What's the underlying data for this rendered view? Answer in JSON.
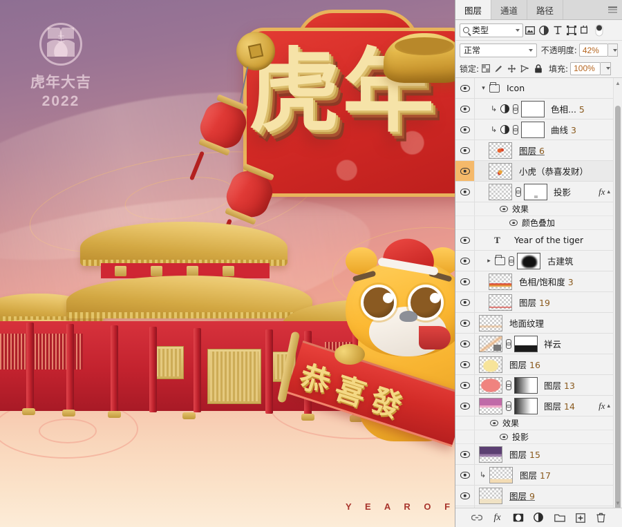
{
  "artwork": {
    "logo": {
      "brand_cn": "虎年大吉",
      "year": "2022",
      "mark": "tiger-head-icon"
    },
    "headline": "虎年",
    "banner_text": "恭喜發",
    "bottom_text": "Y E A R   O F   T H",
    "decor": [
      "red-lantern",
      "gold-coin",
      "gold-ingot",
      "palace-architecture",
      "tiger-mascot"
    ]
  },
  "panel": {
    "tabs": [
      {
        "label": "图层",
        "active": true
      },
      {
        "label": "通道",
        "active": false
      },
      {
        "label": "路径",
        "active": false
      }
    ],
    "menu_icon": "panel-menu-icon",
    "filter": {
      "search_icon": "search-icon",
      "type_label": "类型",
      "icons": [
        "pixel-filter-icon",
        "adjustment-filter-icon",
        "type-filter-icon",
        "shape-filter-icon",
        "smartobject-filter-icon"
      ],
      "toggle": "filter-toggle"
    },
    "blend": {
      "mode": "正常",
      "opacity_label": "不透明度:",
      "opacity_value": "42%"
    },
    "lock": {
      "label": "锁定:",
      "icons": [
        "lock-transparent-icon",
        "lock-image-icon",
        "lock-position-icon",
        "lock-artboard-icon",
        "lock-all-icon"
      ],
      "fill_label": "填充:",
      "fill_value": "100%"
    },
    "layers": [
      {
        "name": "Icon",
        "kind": "group",
        "expanded": true,
        "visible": true,
        "indent": 0,
        "thumb": "none"
      },
      {
        "name": "色相...",
        "num": "5",
        "kind": "adjustment",
        "visible": true,
        "clipped": true,
        "mask": "white",
        "linked": true,
        "indent": 1
      },
      {
        "name": "曲线",
        "num": "3",
        "kind": "adjustment",
        "visible": true,
        "clipped": true,
        "mask": "white",
        "linked": true,
        "indent": 1
      },
      {
        "name": "图层",
        "num": "6",
        "kind": "pixel",
        "visible": true,
        "indent": 1,
        "underline": true,
        "thumb": "confetti"
      },
      {
        "name": "小虎（恭喜发财）",
        "kind": "pixel",
        "visible": true,
        "selected": true,
        "indent": 1,
        "thumb": "tiger"
      },
      {
        "name": "投影",
        "kind": "pixel",
        "visible": true,
        "indent": 1,
        "mask": "white",
        "linked": true,
        "fx": true,
        "effects": [
          {
            "name": "效果"
          },
          {
            "name": "颜色叠加"
          }
        ]
      },
      {
        "name": "Year of the tiger",
        "kind": "text",
        "visible": true,
        "indent": 1
      },
      {
        "name": "古建筑",
        "kind": "group",
        "expanded": false,
        "visible": true,
        "indent": 1,
        "mask": "heart",
        "linked": true
      },
      {
        "name": "色相/饱和度",
        "num": "3",
        "kind": "pixel",
        "visible": true,
        "indent": 1,
        "thumb": "redwave"
      },
      {
        "name": "图层",
        "num": "19",
        "kind": "pixel",
        "visible": true,
        "indent": 1,
        "thumb": "redline"
      },
      {
        "name": "地面纹理",
        "kind": "pixel",
        "visible": true,
        "indent": 0,
        "thumb": "ground"
      },
      {
        "name": "祥云",
        "kind": "pixel",
        "visible": true,
        "indent": 0,
        "mask": "gradient",
        "linked": true,
        "thumb": "cloud"
      },
      {
        "name": "图层",
        "num": "16",
        "kind": "pixel",
        "visible": true,
        "indent": 0,
        "thumb": "yellowblob"
      },
      {
        "name": "图层",
        "num": "13",
        "kind": "pixel",
        "visible": true,
        "indent": 0,
        "mask": "gradient",
        "linked": true,
        "thumb": "pinkblob"
      },
      {
        "name": "图层",
        "num": "14",
        "kind": "pixel",
        "visible": true,
        "indent": 0,
        "mask": "gradient",
        "linked": true,
        "fx": true,
        "thumb": "purplepink",
        "effects": [
          {
            "name": "效果"
          },
          {
            "name": "投影"
          }
        ]
      },
      {
        "name": "图层",
        "num": "15",
        "kind": "pixel",
        "visible": true,
        "indent": 0,
        "thumb": "purpleblob"
      },
      {
        "name": "图层",
        "num": "17",
        "kind": "pixel",
        "visible": true,
        "indent": 0,
        "clipped": true,
        "thumb": "creambar"
      },
      {
        "name": "图层",
        "num": "9",
        "kind": "pixel",
        "visible": true,
        "indent": 0,
        "underline": true,
        "thumb": "creambar2"
      }
    ],
    "bottom_icons": [
      "link-layers-icon",
      "layer-style-fx-icon",
      "add-mask-icon",
      "new-adjustment-icon",
      "new-group-icon",
      "new-layer-icon",
      "delete-layer-icon"
    ]
  },
  "colors": {
    "selection_orange": "#f5b96a",
    "panel_bg": "#f2f2f2",
    "tab_inactive": "#d9d9d9",
    "value_text": "#b5651f"
  }
}
